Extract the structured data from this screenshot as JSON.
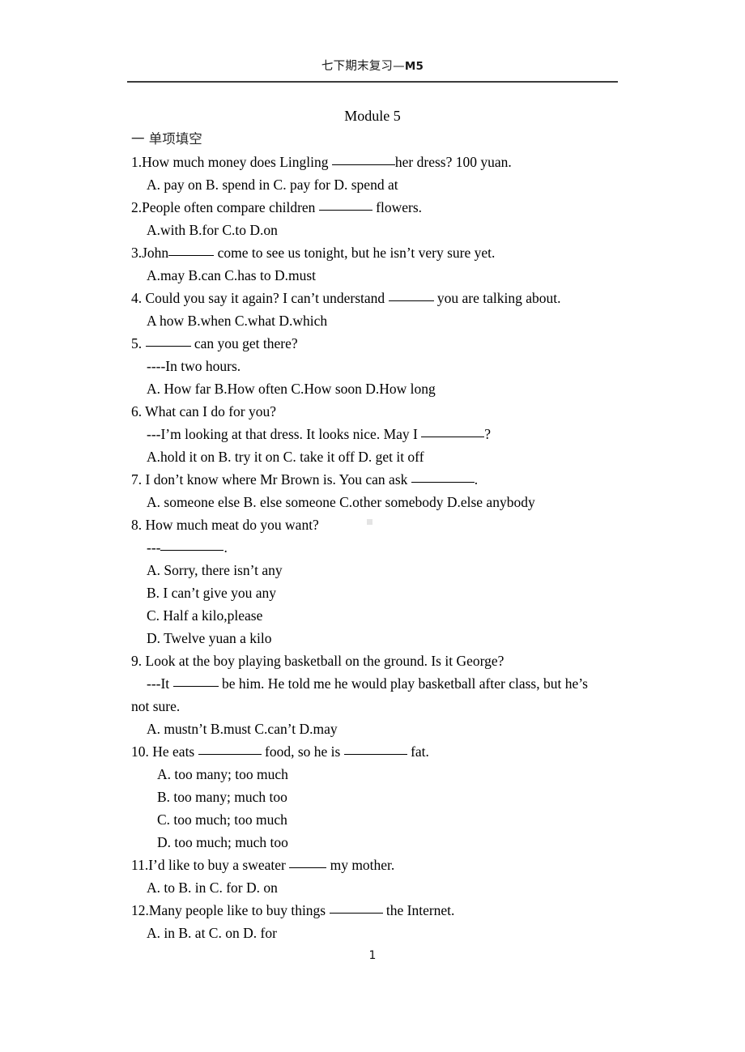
{
  "header": {
    "running_title_cn": "七下期末复习",
    "running_title_dash": "—",
    "running_title_module": "M5"
  },
  "document": {
    "title": "Module 5",
    "section_heading": "一  单项填空",
    "page_number": "1"
  },
  "questions": [
    {
      "stem_pre": "1.How much money does Lingling ",
      "stem_post": "her dress? 100 yuan.",
      "options": "A. pay on   B. spend in   C. pay for   D. spend at"
    },
    {
      "stem_pre": "2.People often compare children ",
      "stem_post": " flowers.",
      "options": "A.with   B.for     C.to      D.on"
    },
    {
      "stem_pre": "3.John",
      "stem_post": " come to see us tonight, but he isn’t very sure yet.",
      "options": "A.may     B.can     C.has to    D.must"
    },
    {
      "stem_pre": "4. Could you say it again? I can’t understand ",
      "stem_post": " you are talking about.",
      "options": "A how   B.when   C.what   D.which"
    },
    {
      "stem_pre": "5. ",
      "stem_post": " can you get there?",
      "reply": "----In two hours.",
      "options": "A. How far   B.How often   C.How soon   D.How long"
    },
    {
      "stem_pre": "6. What can I do for you?",
      "reply_pre": "---I’m looking at that dress. It looks nice. May I ",
      "reply_post": "?",
      "options": "A.hold it on B. try it on C. take it off D. get it off"
    },
    {
      "stem_pre": "7. I don’t know where Mr Brown is. You can ask ",
      "stem_post": ".",
      "options": "A. someone else B. else someone C.other somebody D.else anybody"
    },
    {
      "stem_pre": "8. How much meat do you want?",
      "reply_pre": "---",
      "reply_post": ".",
      "option_lines": [
        "A. Sorry, there isn’t any",
        "B. I can’t give you any",
        "C. Half a kilo,please",
        "D. Twelve yuan a kilo"
      ]
    },
    {
      "stem_pre": "9. Look at the boy playing basketball on the ground. Is it George?",
      "reply_pre": "---It ",
      "reply_post": " be him. He told me he would play basketball after class, but he’s",
      "reply_cont": "not sure.",
      "options": "A. mustn’t   B.must   C.can’t   D.may"
    },
    {
      "stem_pre": "10. He eats ",
      "stem_mid": " food, so he is ",
      "stem_post": " fat.",
      "option_lines": [
        "A. too many; too much",
        "B. too many; much too",
        "C. too much; too much",
        "D. too much; much too"
      ]
    },
    {
      "stem_pre": "11.I’d like to buy a sweater ",
      "stem_post": " my mother.",
      "options": "A. to     B. in    C. for     D. on"
    },
    {
      "stem_pre": "12.Many people like to buy things ",
      "stem_post": " the Internet.",
      "options": "A. in      B. at      C. on     D. for"
    }
  ]
}
